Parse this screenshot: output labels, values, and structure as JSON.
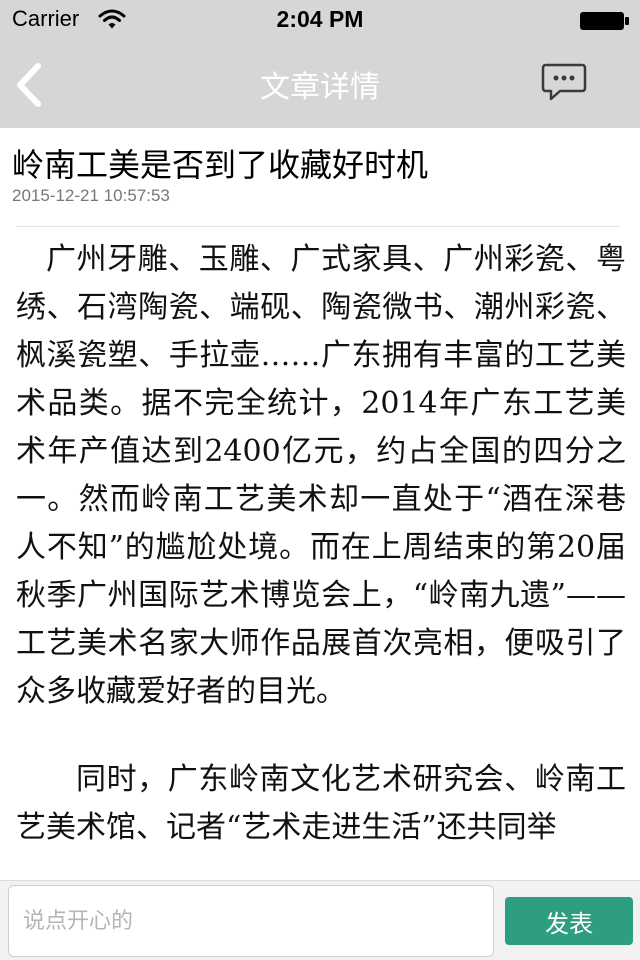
{
  "status_bar": {
    "carrier": "Carrier",
    "time": "2:04 PM",
    "icons": [
      "wifi-icon",
      "battery-icon"
    ]
  },
  "nav": {
    "title": "文章详情",
    "back_icon": "back-chevron-icon",
    "comment_icon": "comment-bubble-icon"
  },
  "article": {
    "title": "岭南工美是否到了收藏好时机",
    "date": "2015-12-21 10:57:53",
    "paragraphs": [
      "广州牙雕、玉雕、广式家具、广州彩瓷、粤绣、石湾陶瓷、端砚、陶瓷微书、潮州彩瓷、枫溪瓷塑、手拉壶……广东拥有丰富的工艺美术品类。据不完全统计，2014年广东工艺美术年产值达到2400亿元，约占全国的四分之一。然而岭南工艺美术却一直处于“酒在深巷人不知”的尴尬处境。而在上周结束的第20届秋季广州国际艺术博览会上，“岭南九遗”——工艺美术名家大师作品展首次亮相，便吸引了众多收藏爱好者的目光。",
      "同时，广东岭南文化艺术研究会、岭南工艺美术馆、记者“艺术走进生活”还共同举"
    ]
  },
  "footer": {
    "input_placeholder": "说点开心的",
    "submit_label": "发表"
  },
  "colors": {
    "header_bg": "#d6d6d6",
    "submit_bg": "#2e9e80",
    "date_text": "#777777"
  }
}
